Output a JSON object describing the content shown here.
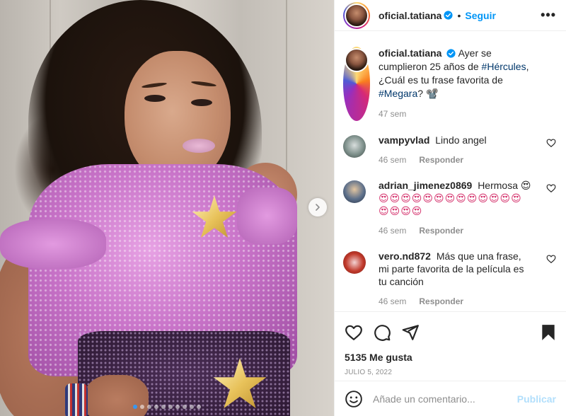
{
  "header": {
    "username": "oficial.tatiana",
    "separator": "•",
    "follow_label": "Seguir",
    "more_icon": "more-horizontal-icon"
  },
  "caption": {
    "username": "oficial.tatiana",
    "text_before": "Ayer se cumplieron 25 años de ",
    "tag1": "#Hércules",
    "text_mid": ", ¿Cuál es tu frase favorita de ",
    "tag2": "#Megara",
    "text_after": "? 📽️",
    "time": "47 sem"
  },
  "comments": [
    {
      "username": "vampyvlad",
      "text": "Lindo angel",
      "time": "46 sem",
      "reply_label": "Responder",
      "avatar_color": "#7d8f8a"
    },
    {
      "username": "adrian_jimenez0869",
      "text": "Hermosa 😍",
      "emojis": "😍😍😍😍😍😍😍😍😍😍😍😍😍😍😍😍😍",
      "time": "46 sem",
      "reply_label": "Responder",
      "avatar_color": "#5c6f8a"
    },
    {
      "username": "vero.nd872",
      "text": "Más que una frase, mi parte favorita de la película es tu canción",
      "time": "46 sem",
      "reply_label": "Responder",
      "avatar_color": "#c0392b"
    }
  ],
  "actions": {
    "likes": "5135 Me gusta",
    "date": "JULIO 5, 2022"
  },
  "add_comment": {
    "placeholder": "Añade un comentario...",
    "post_label": "Publicar"
  },
  "carousel": {
    "dot_count": 10,
    "active_index": 0
  },
  "colors": {
    "accent": "#0095f6",
    "post_disabled": "#b2dffc",
    "hashtag": "#00376b",
    "muted": "#8e8e8e"
  }
}
